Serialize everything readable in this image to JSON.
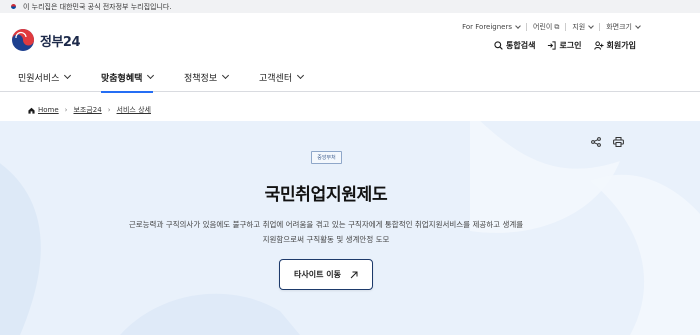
{
  "notice": {
    "text": "이 누리집은 대한민국 공식 전자정부 누리집입니다."
  },
  "logo": {
    "text": "정부",
    "number": "24"
  },
  "utility": [
    {
      "label": "For Foreigners",
      "icon": "chevron-down-icon"
    },
    {
      "label": "어린이",
      "icon": "external-link-icon"
    },
    {
      "label": "지원",
      "icon": "chevron-down-icon"
    },
    {
      "label": "화면크기",
      "icon": "chevron-down-icon"
    }
  ],
  "actions": {
    "search": "통합검색",
    "login": "로그인",
    "signup": "회원가입"
  },
  "nav": [
    {
      "label": "민원서비스"
    },
    {
      "label": "맞춤형혜택"
    },
    {
      "label": "정책정보"
    },
    {
      "label": "고객센터"
    }
  ],
  "breadcrumb": {
    "home": "Home",
    "level1": "보조금24",
    "level2": "서비스 상세"
  },
  "hero": {
    "badge": "중앙부처",
    "title": "국민취업지원제도",
    "desc_line1": "근로능력과 구직의사가 있음에도 불구하고 취업에 어려움을 겪고 있는 구직자에게 통합적인 취업지원서비스를 제공하고 생계를",
    "desc_line2": "지원함으로써 구직활동 및 생계안정 도모",
    "cta": "타사이트 이동"
  },
  "colors": {
    "accent": "#256ef4",
    "hero_bg": "#e9f1fb",
    "navy": "#1d2a4a"
  }
}
